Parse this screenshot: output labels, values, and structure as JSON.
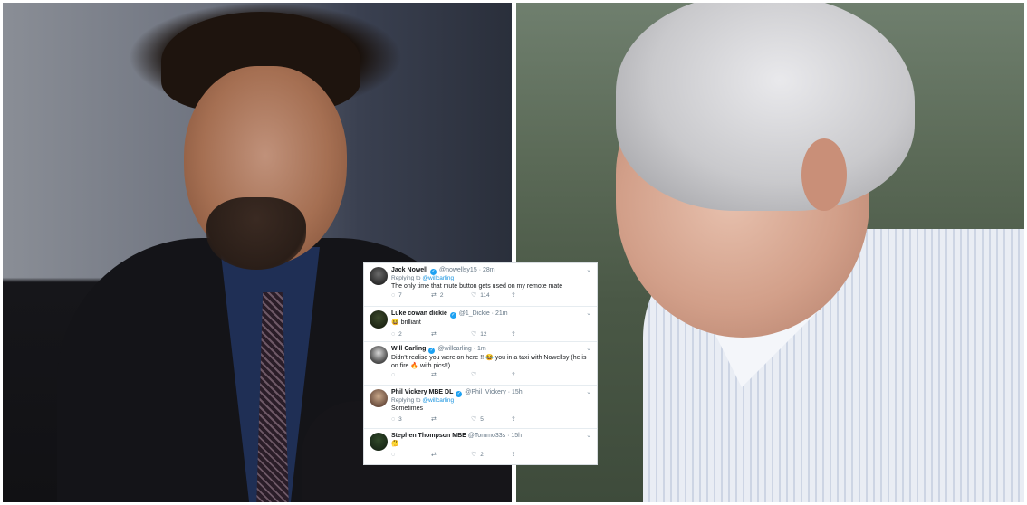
{
  "tweets": [
    {
      "name": "Jack Nowell",
      "handle": "@nowellsy15",
      "time": "· 28m",
      "reply_prefix": "Replying to",
      "reply_to": "@willcarling",
      "text": "The only time that mute button gets used on my remote mate",
      "replies": "7",
      "retweets": "2",
      "likes": "114"
    },
    {
      "name": "Luke cowan dickie",
      "handle": "@1_Dickie",
      "time": "· 21m",
      "text": "😆 brilliant",
      "replies": "2",
      "retweets": "",
      "likes": "12"
    },
    {
      "name": "Will Carling",
      "handle": "@willcarling",
      "time": "· 1m",
      "text": "Didn't realise you were on here !! 😂 you in a taxi with Nowellsy (he is on fire 🔥 with pics!!)",
      "replies": "",
      "retweets": "",
      "likes": ""
    },
    {
      "name": "Phil Vickery MBE DL",
      "handle": "@Phil_Vickery",
      "time": "· 15h",
      "reply_prefix": "Replying to",
      "reply_to": "@willcarling",
      "text": "Sometimes",
      "replies": "3",
      "retweets": "",
      "likes": "5"
    },
    {
      "name": "Stephen Thompson MBE",
      "handle": "@Tommo33s",
      "time": "· 15h",
      "text": "🤔",
      "replies": "",
      "retweets": "",
      "likes": "2"
    }
  ],
  "icons": {
    "reply": "speech-bubble-icon",
    "retweet": "retweet-icon",
    "like": "heart-icon",
    "share": "share-icon",
    "verified": "verified-badge-icon",
    "more": "chevron-down-icon"
  },
  "colors": {
    "accent": "#1da1f2",
    "link": "#1b95e0",
    "muted": "#657786"
  }
}
